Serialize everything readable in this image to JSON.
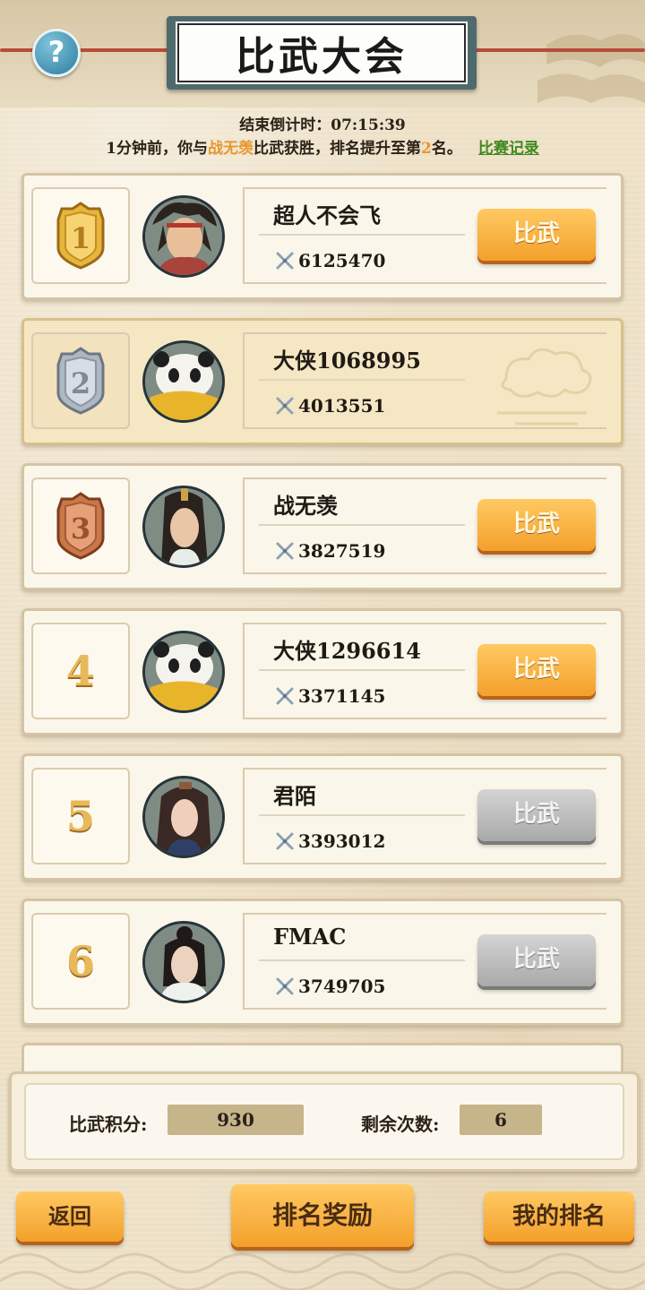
{
  "header": {
    "title": "比武大会",
    "help_icon": "?"
  },
  "countdown": {
    "label": "结束倒计时：",
    "time": "07:15:39"
  },
  "notice": {
    "prefix": "1分钟前，你与",
    "opponent": "战无羡",
    "middle": "比武获胜，排名提升至第",
    "rank": "2",
    "suffix": "名。",
    "link": "比赛记录"
  },
  "rankings": [
    {
      "rank": "1",
      "name": "超人不会飞",
      "power": "6125470",
      "button": "比武",
      "button_state": "active",
      "medal": "gold",
      "avatar": "warrior-headband"
    },
    {
      "rank": "2",
      "name": "大侠1068995",
      "power": "4013551",
      "button": "",
      "button_state": "self",
      "medal": "silver",
      "avatar": "panda"
    },
    {
      "rank": "3",
      "name": "战无羡",
      "power": "3827519",
      "button": "比武",
      "button_state": "active",
      "medal": "bronze",
      "avatar": "swordsman-longhair"
    },
    {
      "rank": "4",
      "name": "大侠1296614",
      "power": "3371145",
      "button": "比武",
      "button_state": "active",
      "medal": "none",
      "avatar": "panda"
    },
    {
      "rank": "5",
      "name": "君陌",
      "power": "3393012",
      "button": "比武",
      "button_state": "disabled",
      "medal": "none",
      "avatar": "lady"
    },
    {
      "rank": "6",
      "name": "FMAC",
      "power": "3749705",
      "button": "比武",
      "button_state": "disabled",
      "medal": "none",
      "avatar": "scholar"
    }
  ],
  "stats": {
    "points_label": "比武积分:",
    "points_value": "930",
    "remaining_label": "剩余次数:",
    "remaining_value": "6"
  },
  "footer": {
    "back": "返回",
    "rewards": "排名奖励",
    "my_rank": "我的排名"
  },
  "colors": {
    "gold_button": "#f3a02b",
    "gray_button": "#a9a9a9",
    "highlight": "#e8962e",
    "link": "#3f8a1f",
    "plate": "#4f6a6c"
  }
}
